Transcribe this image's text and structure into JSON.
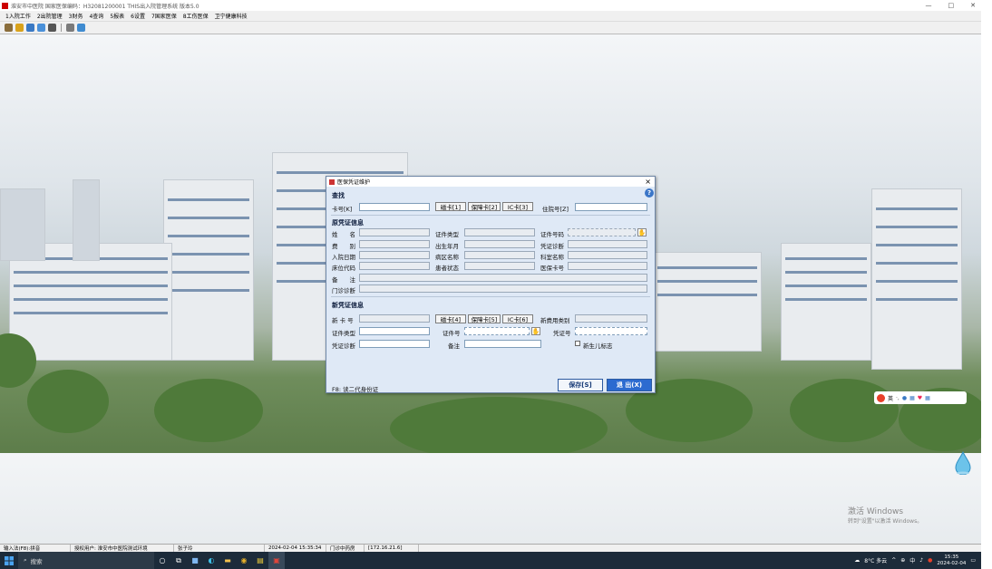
{
  "app": {
    "title": "淮安市中医院 国家医保编码：H32081200001 THIS出入院管理系统 版本5.0",
    "min_glyph": "—",
    "max_glyph": "□",
    "close_glyph": "✕"
  },
  "menu": [
    "1入院工作",
    "2出院管理",
    "3财务",
    "4查询",
    "5报表",
    "6设置",
    "7国家医保",
    "8工伤医保",
    "卫宁健康科技"
  ],
  "dialog": {
    "title": "医保凭证维护",
    "close": "×",
    "help": "?",
    "find": {
      "section": "查找",
      "card_no_label": "卡号[K]",
      "card_btn": "磁卡[1]",
      "insurance_btn": "保障卡[2]",
      "ic_btn": "IC卡[3]",
      "inpatient_label": "住院号[Z]"
    },
    "orig": {
      "section": "原凭证信息",
      "name": "姓　　名",
      "id_type": "证件类型",
      "id_no": "证件号码",
      "fee": "费　　别",
      "birth": "出生年月",
      "diag": "凭证诊断",
      "admit": "入院日期",
      "ward": "病区名称",
      "dept": "科室名称",
      "bed": "床位代码",
      "status": "患者状态",
      "mi_card": "医保卡号",
      "note": "备　　注",
      "outpatient": "门诊诊断"
    },
    "neu": {
      "section": "新凭证信息",
      "card_no": "新 卡 号",
      "card_btn": "磁卡[4]",
      "insurance_btn": "保障卡[5]",
      "ic_btn": "IC卡[6]",
      "fee_type": "新费用类别",
      "id_type": "证件类型",
      "id_no": "证件号",
      "cert_no": "凭证号",
      "diag": "凭证诊断",
      "note": "备注",
      "newborn": "新生儿标志"
    },
    "hint": "F8: 读二代身份证",
    "save": "保存[S]",
    "exit": "退 出(X)"
  },
  "statusbar": [
    "输入法(F8):拼音",
    "授权用户: 淮安市中医院测试环境",
    "张子玲",
    "2024-02-04 15:35:34",
    "门诊中药房",
    "[172.16.21.6]"
  ],
  "ime_bar": "英",
  "watermark": {
    "line1": "激活 Windows",
    "line2": "转到\"设置\"以激活 Windows。"
  },
  "taskbar": {
    "search": "搜索",
    "weather": "8°C 多云",
    "time": "15:35",
    "date": "2024-02-04"
  },
  "colors": {
    "accent": "#2c5aa0",
    "dialog_bg": "#dfe9f6",
    "taskbar": "#1c2b3a"
  }
}
